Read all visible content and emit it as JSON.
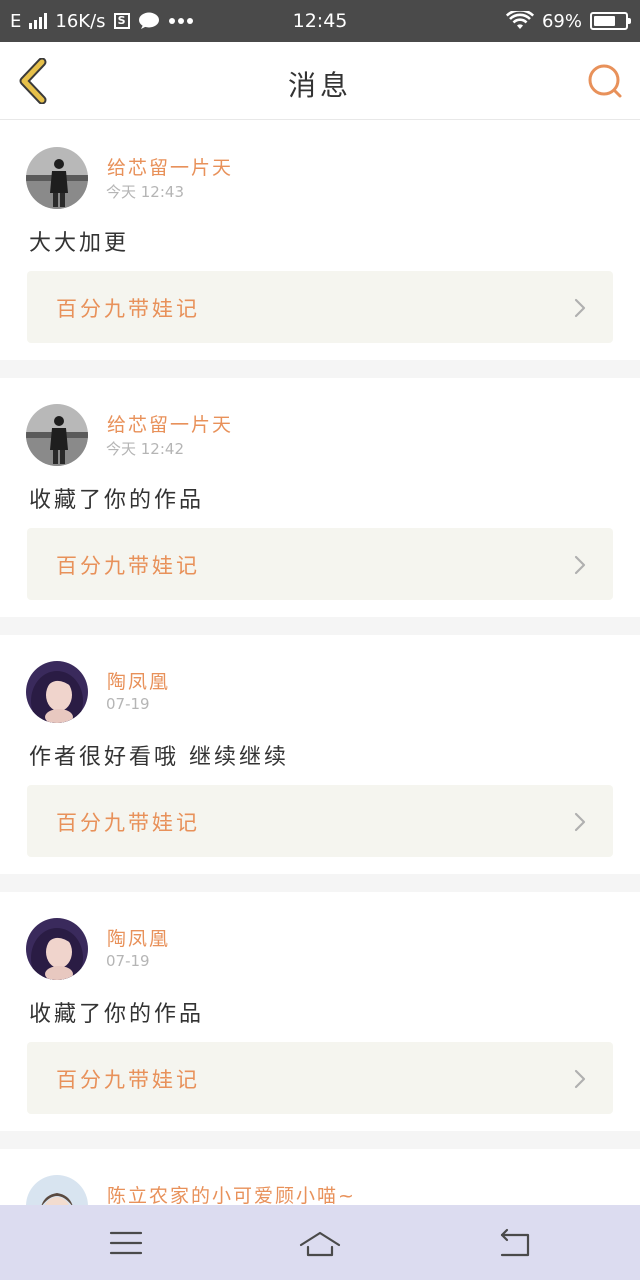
{
  "status_bar": {
    "network": "E",
    "speed": "16K/s",
    "time": "12:45",
    "battery": "69%",
    "battery_level": 0.69
  },
  "nav": {
    "title": "消息"
  },
  "messages": [
    {
      "user": "给芯留一片天",
      "time": "今天 12:43",
      "text": "大大加更",
      "work": "百分九带娃记",
      "avatar": "avatar-photo-1"
    },
    {
      "user": "给芯留一片天",
      "time": "今天 12:42",
      "text": "收藏了你的作品",
      "work": "百分九带娃记",
      "avatar": "avatar-photo-1"
    },
    {
      "user": "陶凤凰",
      "time": "07-19",
      "text": "作者很好看哦 继续继续",
      "work": "百分九带娃记",
      "avatar": "avatar-photo-2"
    },
    {
      "user": "陶凤凰",
      "time": "07-19",
      "text": "收藏了你的作品",
      "work": "百分九带娃记",
      "avatar": "avatar-photo-2"
    },
    {
      "user": "陈立农家的小可爱顾小喵~",
      "avatar": "avatar-photo-3"
    }
  ],
  "colors": {
    "accent": "#e8915a",
    "back_icon": "#e6c04a",
    "status_bar": "#4a4a4a",
    "system_nav": "#dcdcf0"
  }
}
